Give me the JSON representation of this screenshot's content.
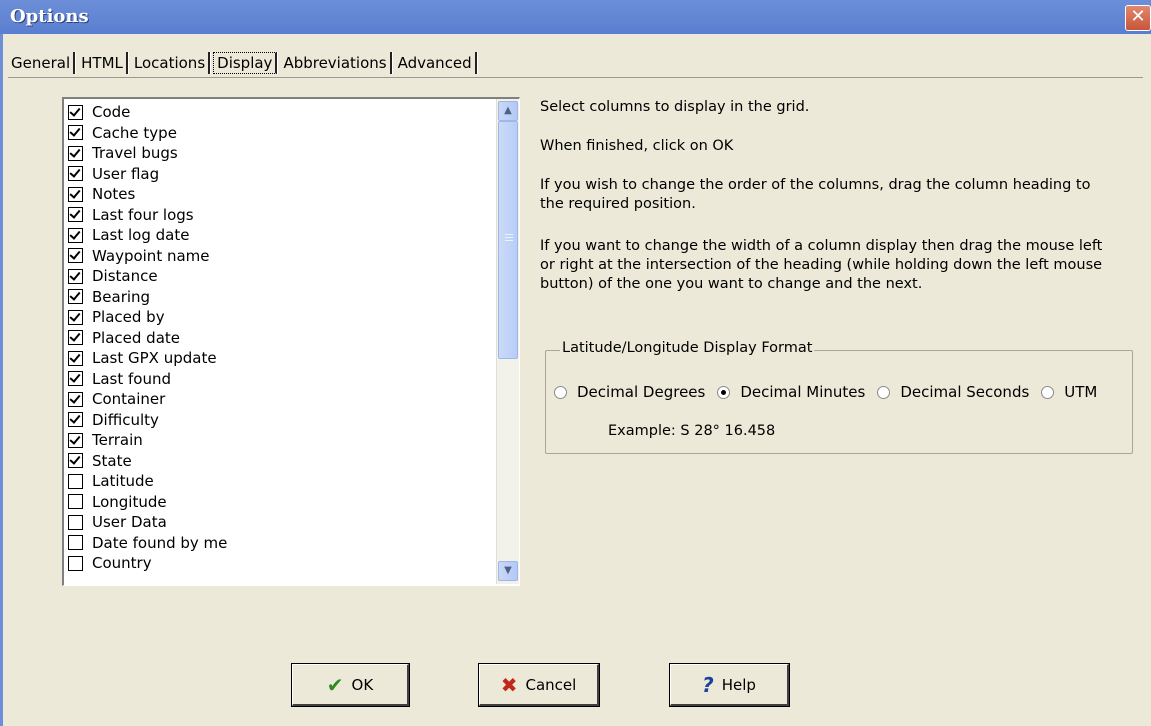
{
  "window": {
    "title": "Options",
    "close_glyph": "✕"
  },
  "tabs": [
    {
      "label": "General",
      "active": false
    },
    {
      "label": "HTML",
      "active": false
    },
    {
      "label": "Locations",
      "active": false
    },
    {
      "label": "Display",
      "active": true
    },
    {
      "label": "Abbreviations",
      "active": false
    },
    {
      "label": "Advanced",
      "active": false
    }
  ],
  "columns_list": {
    "items": [
      {
        "label": "Code",
        "checked": true
      },
      {
        "label": "Cache type",
        "checked": true
      },
      {
        "label": "Travel bugs",
        "checked": true
      },
      {
        "label": "User flag",
        "checked": true
      },
      {
        "label": "Notes",
        "checked": true
      },
      {
        "label": "Last four logs",
        "checked": true
      },
      {
        "label": "Last log date",
        "checked": true
      },
      {
        "label": "Waypoint name",
        "checked": true
      },
      {
        "label": "Distance",
        "checked": true
      },
      {
        "label": "Bearing",
        "checked": true
      },
      {
        "label": "Placed by",
        "checked": true
      },
      {
        "label": "Placed date",
        "checked": true
      },
      {
        "label": "Last GPX update",
        "checked": true
      },
      {
        "label": "Last found",
        "checked": true
      },
      {
        "label": "Container",
        "checked": true
      },
      {
        "label": "Difficulty",
        "checked": true
      },
      {
        "label": "Terrain",
        "checked": true
      },
      {
        "label": "State",
        "checked": true
      },
      {
        "label": "Latitude",
        "checked": false
      },
      {
        "label": "Longitude",
        "checked": false
      },
      {
        "label": "User Data",
        "checked": false
      },
      {
        "label": "Date found by me",
        "checked": false
      },
      {
        "label": "Country",
        "checked": false
      }
    ],
    "scroll_up_icon": "chevron-up-icon",
    "scroll_down_icon": "chevron-down-icon"
  },
  "instructions": {
    "line1": "Select columns to display in the grid.",
    "line2": "When finished, click on OK",
    "line3a": "If you wish to change the order of the columns, drag the column heading to",
    "line3b": "the required position.",
    "line4a": "If you want to change the width of a column display then drag the mouse left",
    "line4b": "or right at the intersection of the heading (while holding down the left mouse",
    "line4c": "button)  of the one you want to change and the next."
  },
  "latlon_format": {
    "title": "Latitude/Longitude Display Format",
    "options": [
      {
        "label": "Decimal Degrees",
        "selected": false
      },
      {
        "label": "Decimal Minutes",
        "selected": true
      },
      {
        "label": "Decimal Seconds",
        "selected": false
      },
      {
        "label": "UTM",
        "selected": false
      }
    ],
    "example": "Example: S 28° 16.458"
  },
  "buttons": {
    "ok": {
      "label": "OK",
      "icon": "checkmark-icon",
      "color": "#2e8b1f"
    },
    "cancel": {
      "label": "Cancel",
      "icon": "x-icon",
      "color": "#c0281e"
    },
    "help": {
      "label": "Help",
      "icon": "question-icon",
      "color": "#1d3f9e"
    }
  }
}
